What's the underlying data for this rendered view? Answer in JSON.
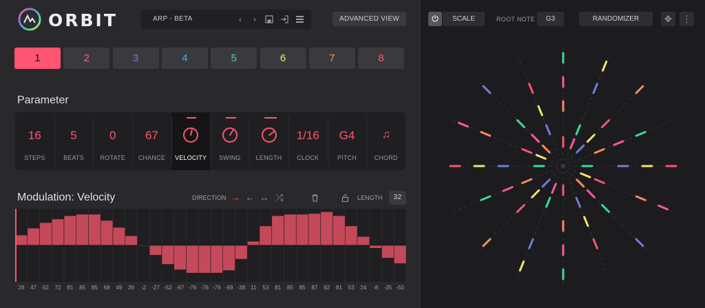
{
  "app": {
    "name": "ORBIT",
    "preset_name": "ARP - BETA",
    "advanced_view_label": "ADVANCED VIEW",
    "accent": "#ff5570"
  },
  "pattern_tabs": [
    {
      "label": "1",
      "color": "#ff5570",
      "active": true
    },
    {
      "label": "2",
      "color": "#ff5a9e",
      "active": false
    },
    {
      "label": "3",
      "color": "#6f7ddf",
      "active": false
    },
    {
      "label": "4",
      "color": "#3fb6e8",
      "active": false
    },
    {
      "label": "5",
      "color": "#3dd8a0",
      "active": false
    },
    {
      "label": "6",
      "color": "#f3e468",
      "active": false
    },
    {
      "label": "7",
      "color": "#ff8a5a",
      "active": false
    },
    {
      "label": "8",
      "color": "#ff5a6e",
      "active": false
    }
  ],
  "parameter": {
    "title": "Parameter",
    "cells": [
      {
        "label": "STEPS",
        "value": "16",
        "kind": "text"
      },
      {
        "label": "BEATS",
        "value": "5",
        "kind": "text"
      },
      {
        "label": "ROTATE",
        "value": "0",
        "kind": "text"
      },
      {
        "label": "CHANCE",
        "value": "67",
        "kind": "text"
      },
      {
        "label": "VELOCITY",
        "value": "",
        "kind": "knob",
        "level": 0.55,
        "active": true
      },
      {
        "label": "SWING",
        "value": "",
        "kind": "knob",
        "level": 0.62
      },
      {
        "label": "LENGTH",
        "value": "",
        "kind": "knob",
        "level": 0.7
      },
      {
        "label": "CLOCK",
        "value": "1/16",
        "kind": "text"
      },
      {
        "label": "PITCH",
        "value": "G4",
        "kind": "text"
      },
      {
        "label": "CHORD",
        "value": "♫",
        "kind": "icon"
      }
    ]
  },
  "modulation": {
    "title": "Modulation: Velocity",
    "direction_label": "DIRECTION",
    "length_label": "LENGTH",
    "length_value": "32",
    "bar_color": "#c4495a",
    "values": [
      28,
      47,
      62,
      72,
      81,
      85,
      85,
      68,
      49,
      26,
      -2,
      -27,
      -52,
      -67,
      -76,
      -76,
      -76,
      -69,
      -38,
      11,
      53,
      81,
      85,
      85,
      87,
      92,
      81,
      53,
      24,
      -8,
      -35,
      -50
    ]
  },
  "right_panel": {
    "scale_label": "SCALE",
    "root_note_label": "ROOT NOTE",
    "root_note_value": "G3",
    "randomizer_label": "RANDOMIZER"
  },
  "icons": {
    "prev": "chevron-left-icon",
    "next": "chevron-right-icon",
    "save": "save-icon",
    "export": "export-icon",
    "menu": "menu-icon",
    "power": "power-icon",
    "move": "move-icon",
    "more": "more-vertical-icon"
  }
}
